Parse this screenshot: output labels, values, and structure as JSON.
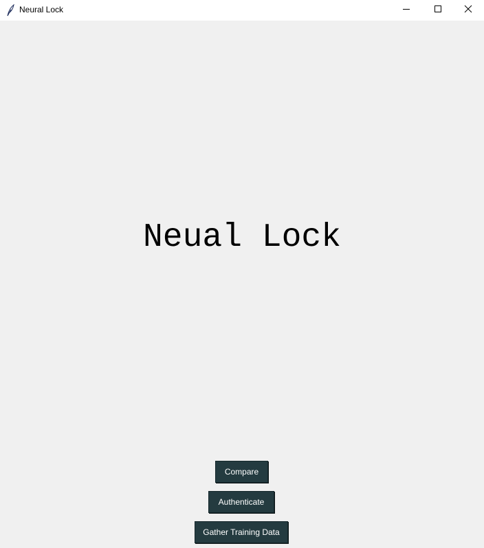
{
  "window": {
    "title": "Neural Lock",
    "app_icon": "feather-icon",
    "controls": {
      "minimize_icon": "minimize-icon",
      "maximize_icon": "maximize-icon",
      "close_icon": "close-icon"
    }
  },
  "main": {
    "heading": "Neual Lock",
    "buttons": {
      "compare": "Compare",
      "authenticate": "Authenticate",
      "gather": "Gather Training Data"
    }
  },
  "colors": {
    "background": "#f0f0f0",
    "button_bg": "#243b40",
    "button_text": "#ffffff"
  }
}
